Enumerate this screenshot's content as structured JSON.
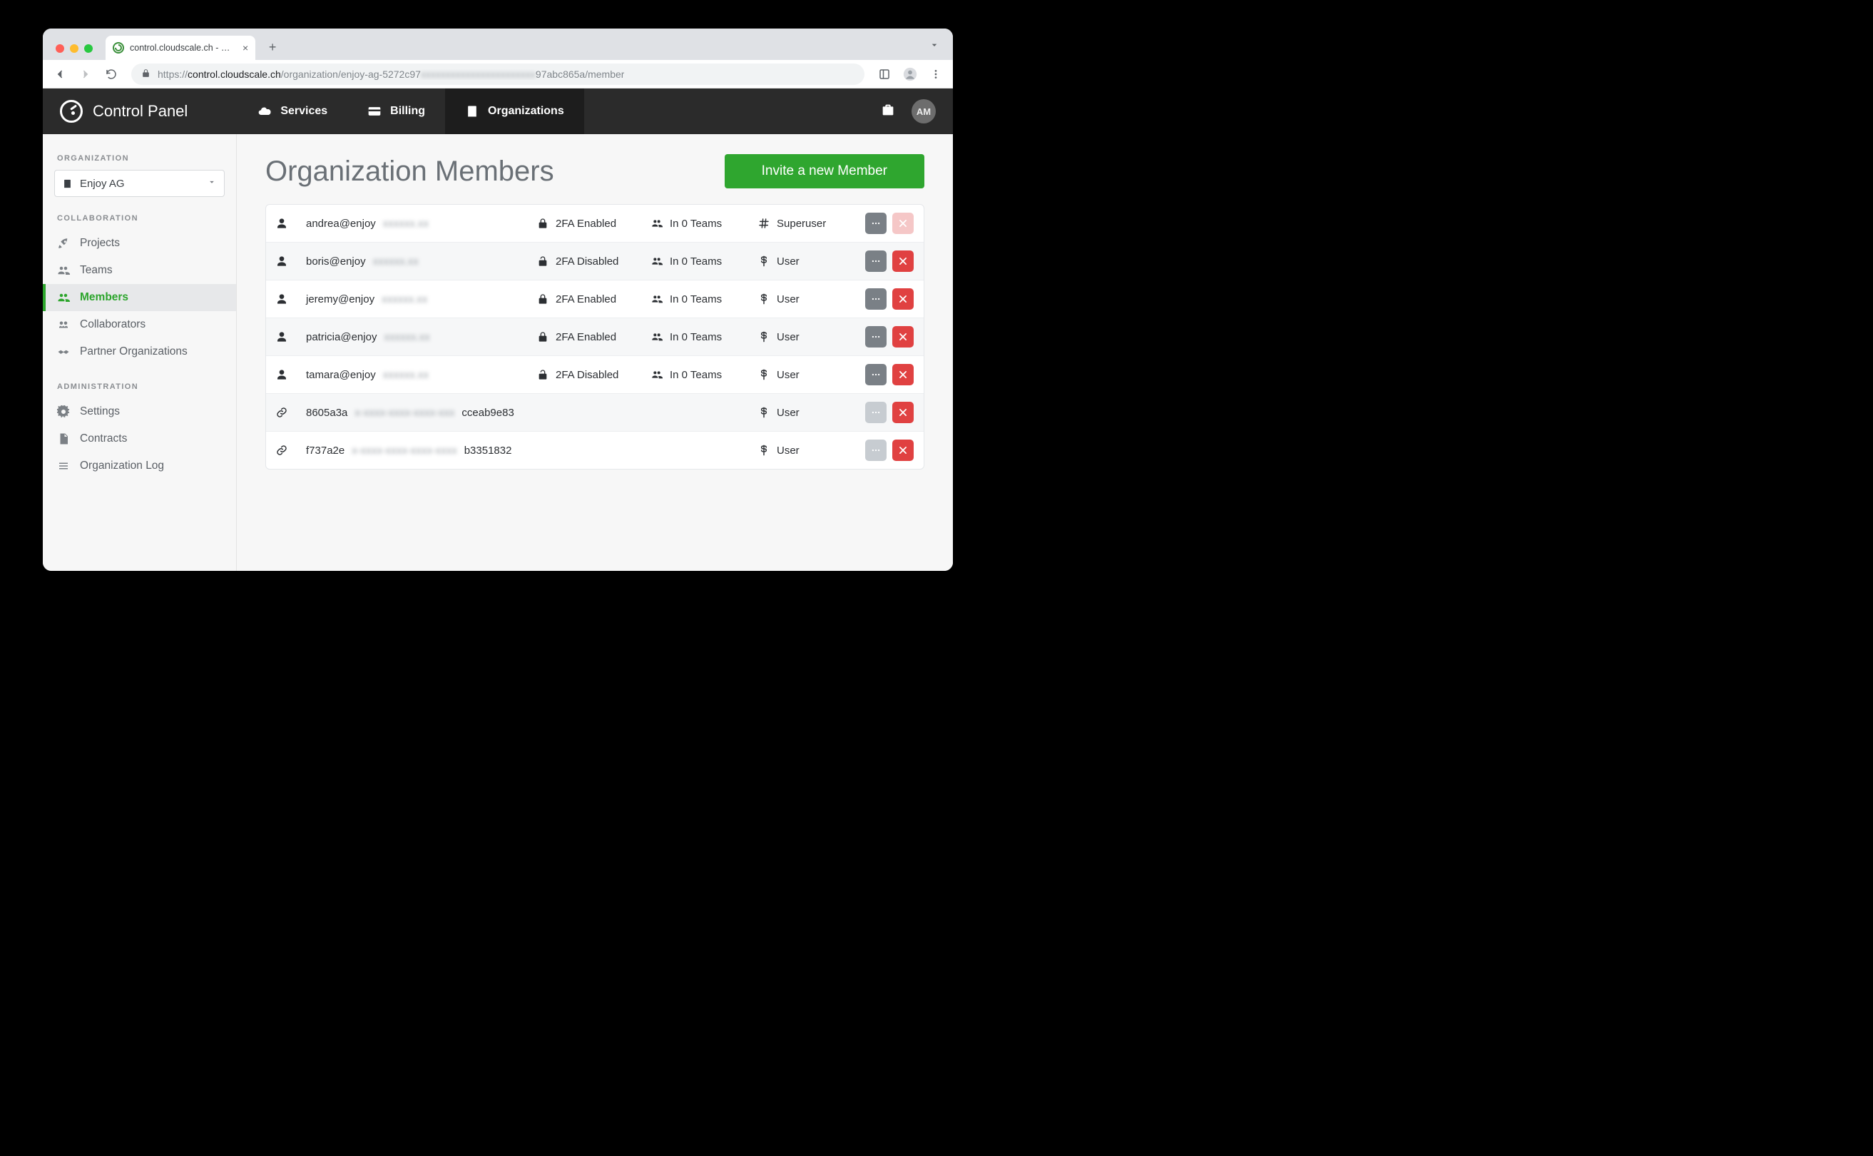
{
  "browser": {
    "tab_title": "control.cloudscale.ch - Organi…",
    "url_prefix": "https://",
    "url_host": "control.cloudscale.ch",
    "url_path_visible_a": "/organization/enjoy-ag-5272c97",
    "url_path_blur": "xxxxxxxxxxxxxxxxxxxxxxx",
    "url_path_visible_b": "97abc865a/member"
  },
  "header": {
    "brand": "Control Panel",
    "nav": {
      "services": "Services",
      "billing": "Billing",
      "organizations": "Organizations"
    },
    "avatar_initials": "AM"
  },
  "sidebar": {
    "heading_org": "ORGANIZATION",
    "selected_org": "Enjoy AG",
    "heading_collab": "COLLABORATION",
    "items_collab": {
      "projects": "Projects",
      "teams": "Teams",
      "members": "Members",
      "collaborators": "Collaborators",
      "partner_orgs": "Partner Organizations"
    },
    "heading_admin": "ADMINISTRATION",
    "items_admin": {
      "settings": "Settings",
      "contracts": "Contracts",
      "org_log": "Organization Log"
    }
  },
  "main": {
    "title": "Organization Members",
    "invite_button": "Invite a new Member"
  },
  "members": [
    {
      "type": "user",
      "email_prefix": "andrea@enjoy",
      "email_blur": "xxxxxx.xx",
      "two_fa": "2FA Enabled",
      "teams": "In 0 Teams",
      "role": "Superuser",
      "role_icon": "hash",
      "more_disabled": false,
      "remove_disabled": true
    },
    {
      "type": "user",
      "email_prefix": "boris@enjoy",
      "email_blur": "xxxxxx.xx",
      "two_fa": "2FA Disabled",
      "teams": "In 0 Teams",
      "role": "User",
      "role_icon": "dollar",
      "more_disabled": false,
      "remove_disabled": false
    },
    {
      "type": "user",
      "email_prefix": "jeremy@enjoy",
      "email_blur": "xxxxxx.xx",
      "two_fa": "2FA Enabled",
      "teams": "In 0 Teams",
      "role": "User",
      "role_icon": "dollar",
      "more_disabled": false,
      "remove_disabled": false
    },
    {
      "type": "user",
      "email_prefix": "patricia@enjoy",
      "email_blur": "xxxxxx.xx",
      "two_fa": "2FA Enabled",
      "teams": "In 0 Teams",
      "role": "User",
      "role_icon": "dollar",
      "more_disabled": false,
      "remove_disabled": false
    },
    {
      "type": "user",
      "email_prefix": "tamara@enjoy",
      "email_blur": "xxxxxx.xx",
      "two_fa": "2FA Disabled",
      "teams": "In 0 Teams",
      "role": "User",
      "role_icon": "dollar",
      "more_disabled": false,
      "remove_disabled": false
    },
    {
      "type": "link",
      "email_prefix": "8605a3a",
      "email_blur": "x-xxxx-xxxx-xxxx-xxx",
      "email_suffix": "cceab9e83",
      "two_fa": "",
      "teams": "",
      "role": "User",
      "role_icon": "dollar",
      "more_disabled": true,
      "remove_disabled": false
    },
    {
      "type": "link",
      "email_prefix": "f737a2e",
      "email_blur": "x-xxxx-xxxx-xxxx-xxxx",
      "email_suffix": "b3351832",
      "two_fa": "",
      "teams": "",
      "role": "User",
      "role_icon": "dollar",
      "more_disabled": true,
      "remove_disabled": false
    }
  ]
}
